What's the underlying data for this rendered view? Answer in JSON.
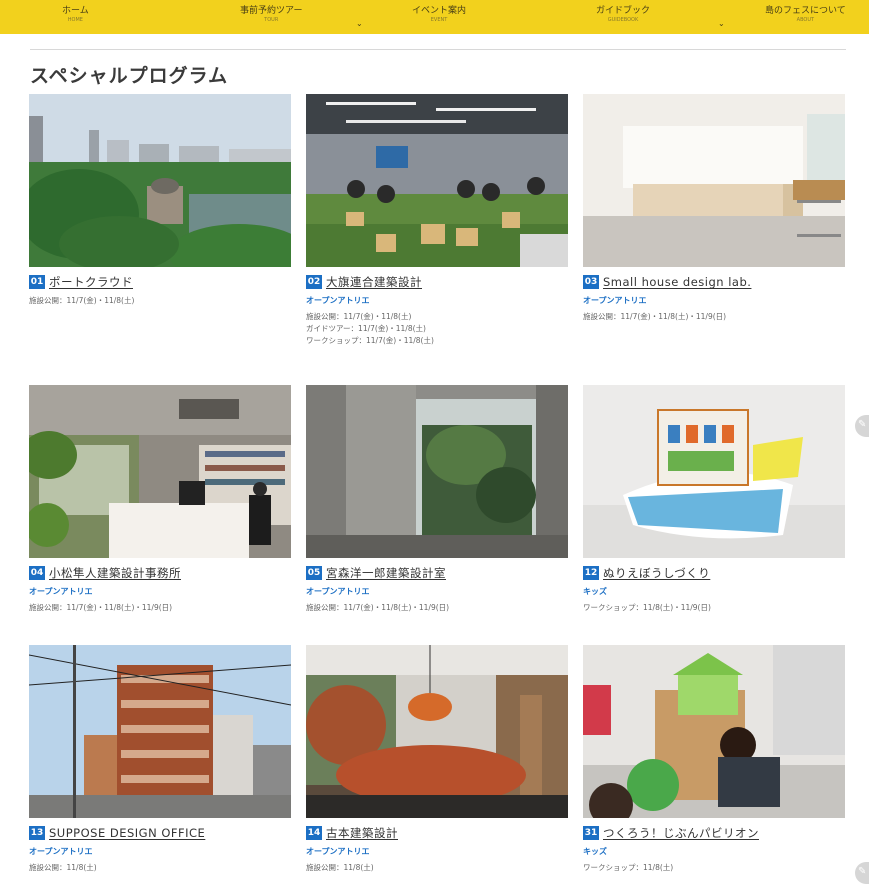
{
  "nav": {
    "items": [
      {
        "label": "ホーム",
        "sub": "HOME"
      },
      {
        "label": "事前予約ツアー",
        "sub": "TOUR"
      },
      {
        "label": "イベント案内",
        "sub": "EVENT"
      },
      {
        "label": "ガイドブック",
        "sub": "GUIDEBOOK"
      },
      {
        "label": "島のフェスについて",
        "sub": "ABOUT"
      }
    ],
    "dropdown_arrow": "⌄"
  },
  "page_title": "スペシャルプログラム",
  "programs": [
    {
      "num": "01",
      "title": "ポートクラウド",
      "category": "",
      "schedule": [
        "施設公開：11/7(金)・11/8(土)"
      ]
    },
    {
      "num": "02",
      "title": "大旗連合建築設計",
      "category": "オープンアトリエ",
      "schedule": [
        "施設公開：11/7(金)・11/8(土)",
        "ガイドツアー：11/7(金)・11/8(土)",
        "ワークショップ：11/7(金)・11/8(土)"
      ]
    },
    {
      "num": "03",
      "title": "Small house design lab.",
      "category": "オープンアトリエ",
      "schedule": [
        "施設公開：11/7(金)・11/8(土)・11/9(日)"
      ]
    },
    {
      "num": "04",
      "title": "小松隼人建築設計事務所",
      "category": "オープンアトリエ",
      "schedule": [
        "施設公開：11/7(金)・11/8(土)・11/9(日)"
      ]
    },
    {
      "num": "05",
      "title": "宮森洋一郎建築設計室",
      "category": "オープンアトリエ",
      "schedule": [
        "施設公開：11/7(金)・11/8(土)・11/9(日)"
      ]
    },
    {
      "num": "12",
      "title": "ぬりえぼうしづくり",
      "category": "キッズ",
      "schedule": [
        "ワークショップ：11/8(土)・11/9(日)"
      ]
    },
    {
      "num": "13",
      "title": "SUPPOSE DESIGN OFFICE",
      "category": "オープンアトリエ",
      "schedule": [
        "施設公開：11/8(土)"
      ]
    },
    {
      "num": "14",
      "title": "古本建築設計",
      "category": "オープンアトリエ",
      "schedule": [
        "施設公開：11/8(土)"
      ]
    },
    {
      "num": "31",
      "title": "つくろう！じぶんパビリオン",
      "category": "キッズ",
      "schedule": [
        "ワークショップ：11/8(土)"
      ]
    }
  ],
  "colors": {
    "nav_bg": "#f2d11d",
    "accent_blue": "#1c6fc4"
  },
  "icons": {
    "side_button": "pencil-icon"
  }
}
